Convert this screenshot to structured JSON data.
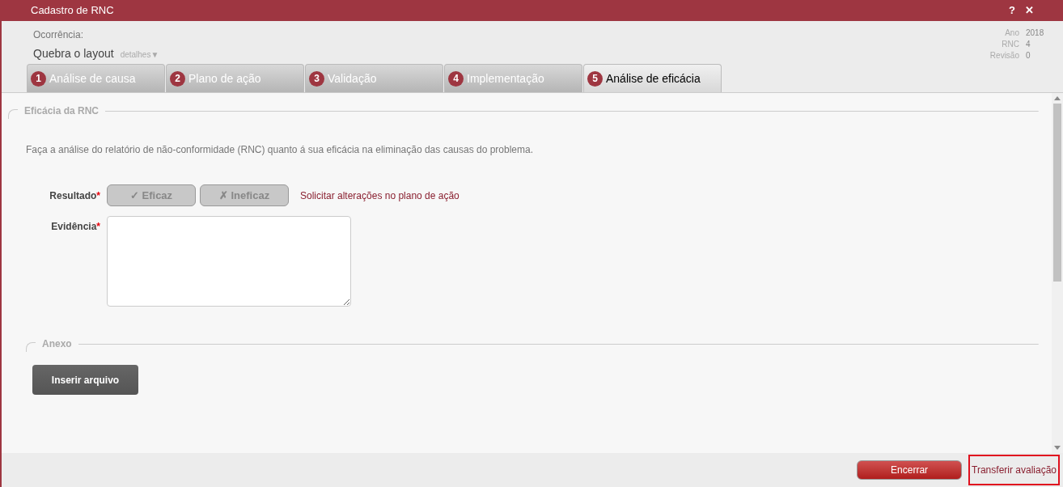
{
  "window": {
    "title": "Cadastro de RNC",
    "buttons": [
      "?",
      "✕"
    ]
  },
  "header": {
    "label": "Ocorrência:",
    "value": "Quebra o layout",
    "details_link": "detalhes▼",
    "meta": [
      {
        "label": "Ano",
        "value": "2018"
      },
      {
        "label": "RNC",
        "value": "4"
      },
      {
        "label": "Revisão",
        "value": "0"
      }
    ]
  },
  "tabs": [
    {
      "number": "1",
      "label": "Análise de causa",
      "selected": false
    },
    {
      "number": "2",
      "label": "Plano de ação",
      "selected": false
    },
    {
      "number": "3",
      "label": "Validação",
      "selected": false
    },
    {
      "number": "4",
      "label": "Implementação",
      "selected": false
    },
    {
      "number": "5",
      "label": "Análise de eficácia",
      "selected": true
    }
  ],
  "section": {
    "title": "Eficácia da RNC",
    "description": "Faça a análise do relatório de não-conformidade (RNC) quanto á sua eficácia na eliminação das causas do problema.",
    "result": {
      "label": "Resultado",
      "required_mark": "*",
      "options": [
        {
          "icon": "✓",
          "label": "Eficaz",
          "selected": false
        },
        {
          "icon": "✗",
          "label": "Ineficaz",
          "selected": false
        }
      ],
      "link": "Solicitar alterações no plano de ação"
    },
    "evidence": {
      "label": "Evidência",
      "required_mark": "*"
    }
  },
  "attachment": {
    "title": "Anexo",
    "button": "Inserir arquivo"
  },
  "footer": {
    "primary": "Encerrar",
    "link": {
      "label": "Transferir avaliação",
      "highlighted": true
    }
  }
}
